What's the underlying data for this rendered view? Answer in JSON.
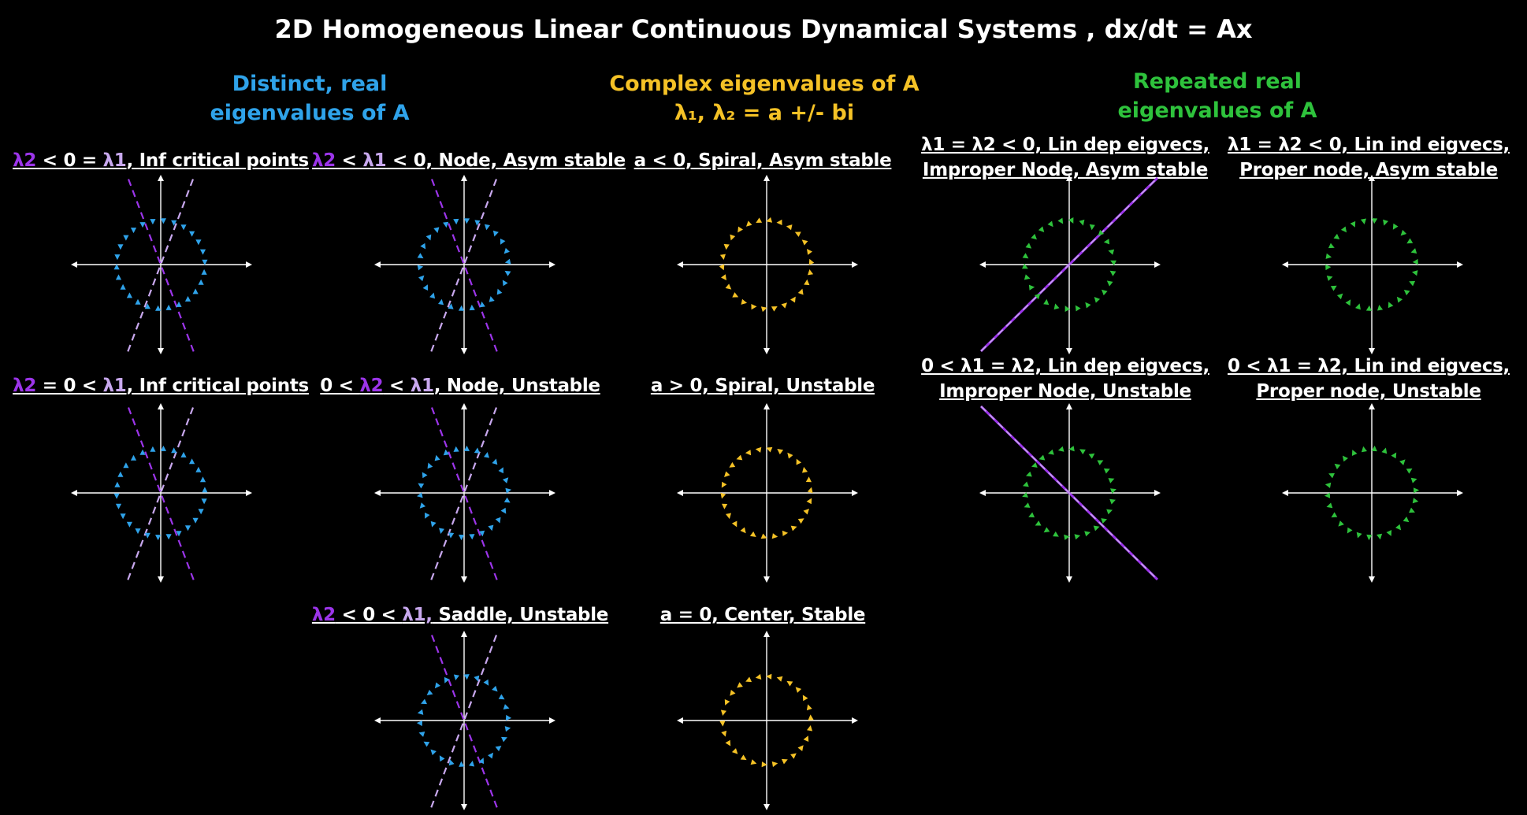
{
  "title": "2D Homogeneous Linear Continuous Dynamical Systems , dx/dt = Ax",
  "colors": {
    "background": "#000000",
    "distinct": "#2fa3ea",
    "complex": "#f5c226",
    "repeated": "#2ec23c",
    "eigvec_purple": "#9c35ea",
    "eigvec_lavender": "#c8a8ee",
    "axis": "#ffffff"
  },
  "groups": {
    "distinct": {
      "line1": "Distinct, real",
      "line2": "eigenvalues of A"
    },
    "complex": {
      "line1": "Complex eigenvalues of A",
      "line2": "λ₁, λ₂ = a +/- bi"
    },
    "repeated": {
      "line1": "Repeated real",
      "line2": "eigenvalues of A"
    }
  },
  "cells": {
    "c1": {
      "l2": "λ2",
      "a": " < 0 = ",
      "l1": "λ1",
      "b": ", Inf critical points"
    },
    "c2": {
      "l2": "λ2",
      "a": " < ",
      "l1": "λ1",
      "b": " < 0, Node,  Asym stable"
    },
    "c3": {
      "text": "a < 0, Spiral, Asym stable"
    },
    "c4": {
      "line1": "λ1 = λ2 < 0, Lin dep eigvecs,",
      "line2": "Improper Node, Asym stable"
    },
    "c5": {
      "line1": "λ1 = λ2 < 0, Lin ind eigvecs,",
      "line2": "Proper node, Asym stable"
    },
    "c6": {
      "l2": "λ2",
      "a": " = 0 < ",
      "l1": "λ1",
      "b": ", Inf critical points"
    },
    "c7": {
      "pre": "0 < ",
      "l2": "λ2",
      "a": " < ",
      "l1": "λ1",
      "b": ", Node, Unstable"
    },
    "c8": {
      "text": "a > 0, Spiral, Unstable"
    },
    "c9": {
      "line1": "0 < λ1 = λ2, Lin dep eigvecs,",
      "line2": "Improper Node, Unstable"
    },
    "c10": {
      "line1": "0 < λ1 = λ2, Lin ind eigvecs,",
      "line2": "Proper node, Unstable"
    },
    "c11": {
      "l2": "λ2",
      "a": " < 0 < ",
      "l1": "λ1,",
      "b": " Saddle, Unstable"
    },
    "c12": {
      "text": "a = 0, Center, Stable"
    }
  },
  "plots": [
    {
      "id": "p1",
      "color": "distinct",
      "dynamics": "line-stable-zero",
      "eigvecs": "cross"
    },
    {
      "id": "p2",
      "color": "distinct",
      "dynamics": "stable-node",
      "eigvecs": "cross"
    },
    {
      "id": "p3",
      "color": "complex",
      "dynamics": "spiral-stable",
      "eigvecs": "none"
    },
    {
      "id": "p4",
      "color": "repeated",
      "dynamics": "improper-stable",
      "eigvecs": "diag-up"
    },
    {
      "id": "p5",
      "color": "repeated",
      "dynamics": "proper-stable",
      "eigvecs": "none"
    },
    {
      "id": "p6",
      "color": "distinct",
      "dynamics": "line-unstable-zero",
      "eigvecs": "cross"
    },
    {
      "id": "p7",
      "color": "distinct",
      "dynamics": "unstable-node",
      "eigvecs": "cross"
    },
    {
      "id": "p8",
      "color": "complex",
      "dynamics": "spiral-unstable",
      "eigvecs": "none"
    },
    {
      "id": "p9",
      "color": "repeated",
      "dynamics": "improper-unstable",
      "eigvecs": "diag-down"
    },
    {
      "id": "p10",
      "color": "repeated",
      "dynamics": "proper-unstable",
      "eigvecs": "none"
    },
    {
      "id": "p11",
      "color": "distinct",
      "dynamics": "saddle",
      "eigvecs": "cross"
    },
    {
      "id": "p12",
      "color": "complex",
      "dynamics": "center",
      "eigvecs": "none"
    }
  ]
}
